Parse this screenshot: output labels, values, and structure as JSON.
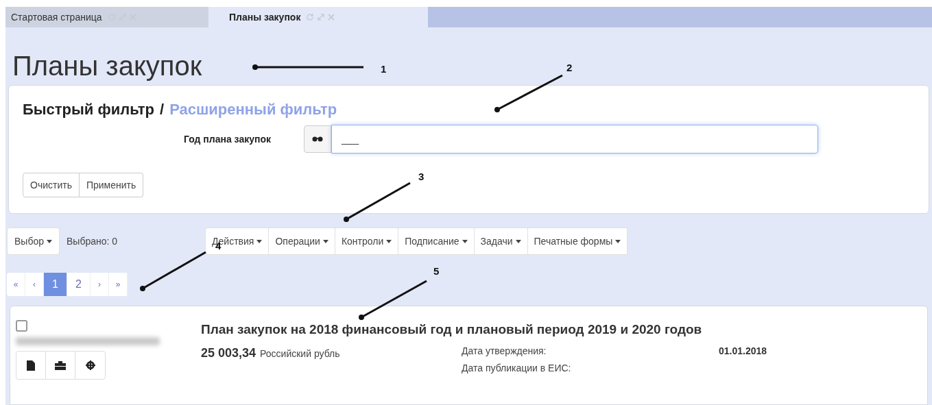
{
  "tabs": [
    {
      "label": "Стартовая страница",
      "selected": false
    },
    {
      "label": "Планы закупок",
      "selected": true
    }
  ],
  "page_title": "Планы закупок",
  "filter": {
    "quick_label": "Быстрый фильтр",
    "separator": "/",
    "advanced_link": "Расширенный фильтр",
    "field_label": "Год плана закупок",
    "field_value": "___",
    "buttons": [
      "Очистить",
      "Применить"
    ]
  },
  "toolbar": {
    "select_button": "Выбор",
    "selected_count": "Выбрано: 0",
    "menus": [
      "Действия",
      "Операции",
      "Контроли",
      "Подписание",
      "Задачи",
      "Печатные формы"
    ]
  },
  "pagination": [
    {
      "label": "«",
      "kind": "nav",
      "selected": false
    },
    {
      "label": "‹",
      "kind": "nav",
      "selected": false
    },
    {
      "label": "1",
      "kind": "page",
      "selected": true
    },
    {
      "label": "2",
      "kind": "page",
      "selected": false
    },
    {
      "label": "›",
      "kind": "nav",
      "selected": false
    },
    {
      "label": "»",
      "kind": "nav",
      "selected": false
    }
  ],
  "record": {
    "checked": false,
    "title": "План закупок на 2018 финансовый год и плановый период 2019 и 2020 годов",
    "amount": "25 003,34",
    "currency": "Российский рубль",
    "fields": [
      {
        "label": "Дата утверждения:",
        "value": "01.01.2018"
      },
      {
        "label": "Дата публикации в ЕИС:"
      }
    ]
  },
  "callouts": [
    "1",
    "2",
    "3",
    "4",
    "5"
  ]
}
